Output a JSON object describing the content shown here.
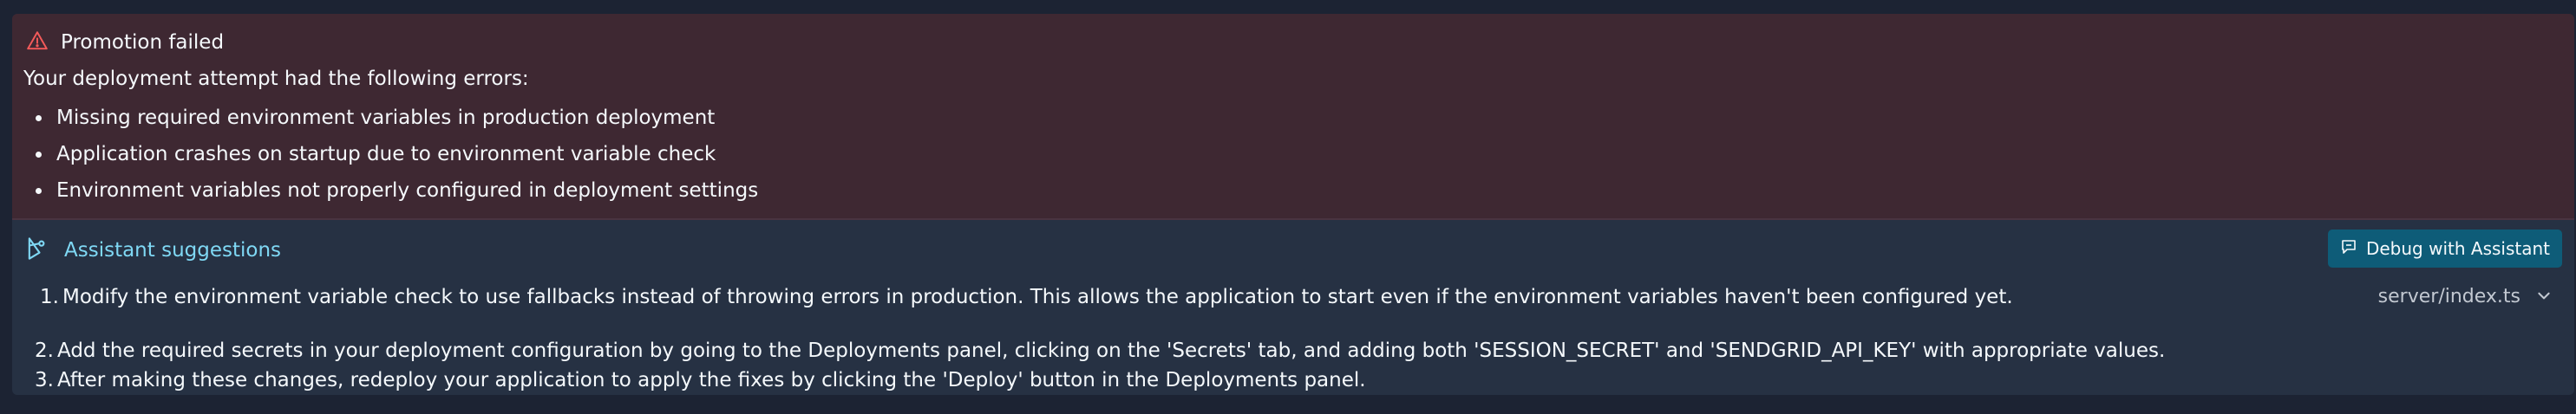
{
  "error": {
    "title": "Promotion failed",
    "intro": "Your deployment attempt had the following errors:",
    "items": [
      "Missing required environment variables in production deployment",
      "Application crashes on startup due to environment variable check",
      "Environment variables not properly configured in deployment settings"
    ]
  },
  "assistant": {
    "title": "Assistant suggestions",
    "debug_button": "Debug with Assistant",
    "file": "server/index.ts",
    "steps": [
      {
        "num": "1.",
        "text": "Modify the environment variable check to use fallbacks instead of throwing errors in production. This allows the application to start even if the environment variables haven't been configured yet."
      },
      {
        "num": "2.",
        "text": "Add the required secrets in your deployment configuration by going to the Deployments panel, clicking on the 'Secrets' tab, and adding both 'SESSION_SECRET' and 'SENDGRID_API_KEY' with appropriate values."
      },
      {
        "num": "3.",
        "text": "After making these changes, redeploy your application to apply the fixes by clicking the 'Deploy' button in the Deployments panel."
      }
    ]
  },
  "colors": {
    "background": "#1c2333",
    "error_bg": "#3e2832",
    "panel_bg": "#263143",
    "warning_icon": "#f45a5a",
    "assistant_accent": "#7fd8f4",
    "button_bg": "#0e5c78"
  },
  "icons": {
    "error": "warning-triangle-icon",
    "assistant": "assistant-icon",
    "debug": "chat-bubble-icon",
    "expand": "chevron-down-icon"
  }
}
